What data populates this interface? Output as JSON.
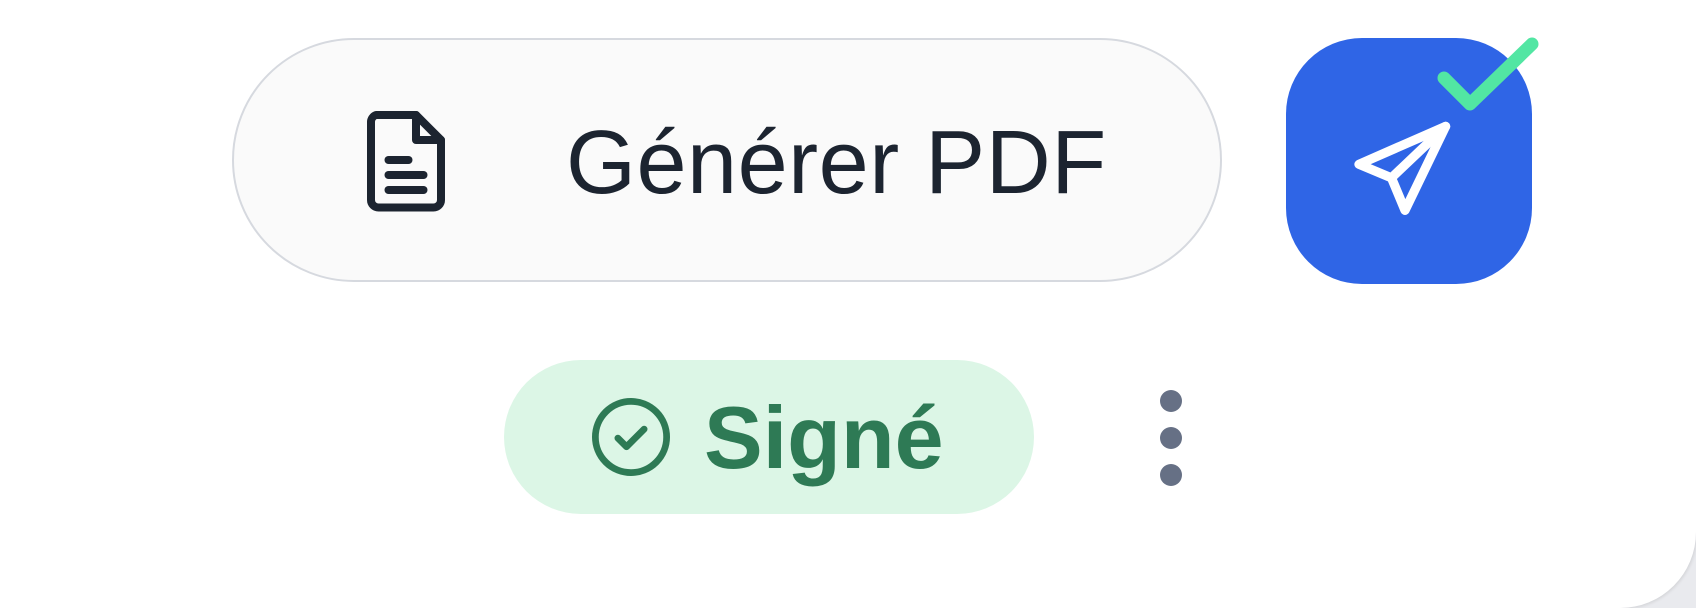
{
  "actions": {
    "generate_pdf_label": "Générer PDF",
    "send_icon": "send-icon"
  },
  "status": {
    "label": "Signé",
    "icon": "check-circle-icon"
  },
  "colors": {
    "primary": "#2f65e6",
    "success_bg": "#dcf6e6",
    "success_text": "#2e7a55",
    "check_accent": "#52e6a3",
    "muted": "#667085",
    "text": "#1c2430"
  }
}
